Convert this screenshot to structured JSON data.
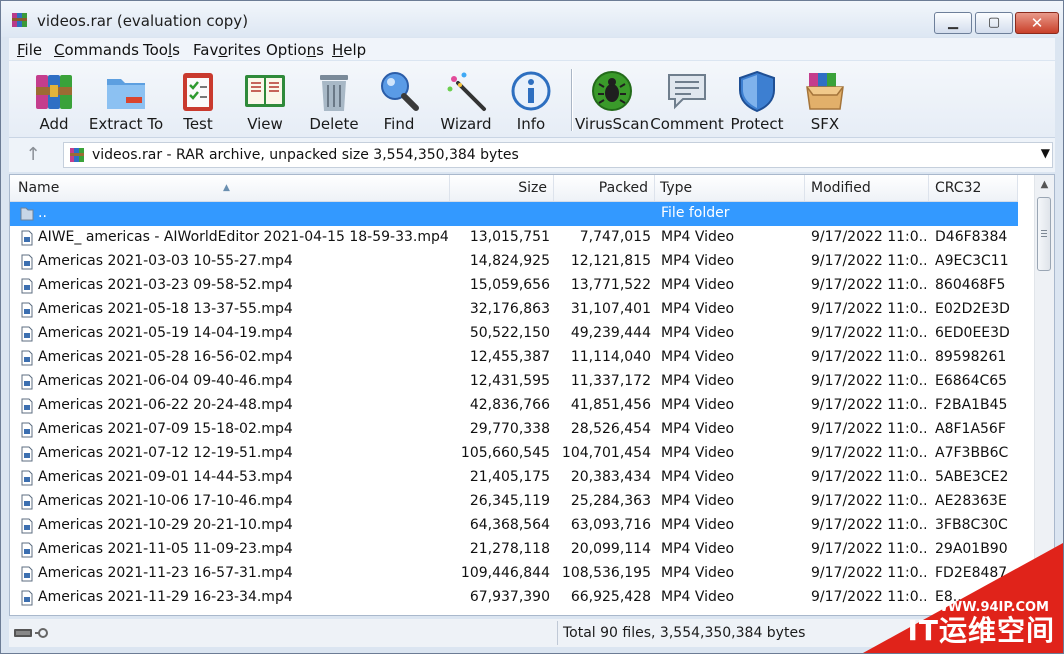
{
  "window": {
    "title": "videos.rar (evaluation copy)",
    "controls": {
      "minimize": "▁",
      "maximize": "▢",
      "close": "✕"
    }
  },
  "menu": [
    {
      "pre": "",
      "u": "F",
      "post": "ile"
    },
    {
      "pre": "",
      "u": "C",
      "post": "ommands"
    },
    {
      "pre": "Too",
      "u": "l",
      "post": "s"
    },
    {
      "pre": "Fav",
      "u": "o",
      "post": "rites"
    },
    {
      "pre": "Optio",
      "u": "n",
      "post": "s"
    },
    {
      "pre": "",
      "u": "H",
      "post": "elp"
    }
  ],
  "toolbar": [
    {
      "label": "Add",
      "icon": "add-archive-icon"
    },
    {
      "label": "Extract To",
      "icon": "extract-folder-icon"
    },
    {
      "label": "Test",
      "icon": "test-clipboard-icon"
    },
    {
      "label": "View",
      "icon": "view-book-icon"
    },
    {
      "label": "Delete",
      "icon": "delete-trash-icon"
    },
    {
      "label": "Find",
      "icon": "find-magnifier-icon"
    },
    {
      "label": "Wizard",
      "icon": "wizard-wand-icon"
    },
    {
      "label": "Info",
      "icon": "info-icon"
    },
    {
      "label": "VirusScan",
      "icon": "virusscan-bug-icon"
    },
    {
      "label": "Comment",
      "icon": "comment-bubble-icon"
    },
    {
      "label": "Protect",
      "icon": "protect-shield-icon"
    },
    {
      "label": "SFX",
      "icon": "sfx-box-icon"
    }
  ],
  "address": {
    "text": "videos.rar - RAR archive, unpacked size 3,554,350,384 bytes"
  },
  "columns": {
    "name": "Name",
    "size": "Size",
    "packed": "Packed",
    "type": "Type",
    "modified": "Modified",
    "crc": "CRC32"
  },
  "parent_row": {
    "name": "..",
    "type": "File folder"
  },
  "files": [
    {
      "name": "AIWE_ americas - AIWorldEditor 2021-04-15 18-59-33.mp4",
      "size": "13,015,751",
      "packed": "7,747,015",
      "type": "MP4 Video",
      "modified": "9/17/2022 11:0...",
      "crc": "D46F8384"
    },
    {
      "name": "Americas 2021-03-03 10-55-27.mp4",
      "size": "14,824,925",
      "packed": "12,121,815",
      "type": "MP4 Video",
      "modified": "9/17/2022 11:0...",
      "crc": "A9EC3C11"
    },
    {
      "name": "Americas 2021-03-23 09-58-52.mp4",
      "size": "15,059,656",
      "packed": "13,771,522",
      "type": "MP4 Video",
      "modified": "9/17/2022 11:0...",
      "crc": "860468F5"
    },
    {
      "name": "Americas 2021-05-18 13-37-55.mp4",
      "size": "32,176,863",
      "packed": "31,107,401",
      "type": "MP4 Video",
      "modified": "9/17/2022 11:0...",
      "crc": "E02D2E3D"
    },
    {
      "name": "Americas 2021-05-19 14-04-19.mp4",
      "size": "50,522,150",
      "packed": "49,239,444",
      "type": "MP4 Video",
      "modified": "9/17/2022 11:0...",
      "crc": "6ED0EE3D"
    },
    {
      "name": "Americas 2021-05-28 16-56-02.mp4",
      "size": "12,455,387",
      "packed": "11,114,040",
      "type": "MP4 Video",
      "modified": "9/17/2022 11:0...",
      "crc": "89598261"
    },
    {
      "name": "Americas 2021-06-04 09-40-46.mp4",
      "size": "12,431,595",
      "packed": "11,337,172",
      "type": "MP4 Video",
      "modified": "9/17/2022 11:0...",
      "crc": "E6864C65"
    },
    {
      "name": "Americas 2021-06-22 20-24-48.mp4",
      "size": "42,836,766",
      "packed": "41,851,456",
      "type": "MP4 Video",
      "modified": "9/17/2022 11:0...",
      "crc": "F2BA1B45"
    },
    {
      "name": "Americas 2021-07-09 15-18-02.mp4",
      "size": "29,770,338",
      "packed": "28,526,454",
      "type": "MP4 Video",
      "modified": "9/17/2022 11:0...",
      "crc": "A8F1A56F"
    },
    {
      "name": "Americas 2021-07-12 12-19-51.mp4",
      "size": "105,660,545",
      "packed": "104,701,454",
      "type": "MP4 Video",
      "modified": "9/17/2022 11:0...",
      "crc": "A7F3BB6C"
    },
    {
      "name": "Americas 2021-09-01 14-44-53.mp4",
      "size": "21,405,175",
      "packed": "20,383,434",
      "type": "MP4 Video",
      "modified": "9/17/2022 11:0...",
      "crc": "5ABE3CE2"
    },
    {
      "name": "Americas 2021-10-06 17-10-46.mp4",
      "size": "26,345,119",
      "packed": "25,284,363",
      "type": "MP4 Video",
      "modified": "9/17/2022 11:0...",
      "crc": "AE28363E"
    },
    {
      "name": "Americas 2021-10-29 20-21-10.mp4",
      "size": "64,368,564",
      "packed": "63,093,716",
      "type": "MP4 Video",
      "modified": "9/17/2022 11:0...",
      "crc": "3FB8C30C"
    },
    {
      "name": "Americas 2021-11-05 11-09-23.mp4",
      "size": "21,278,118",
      "packed": "20,099,114",
      "type": "MP4 Video",
      "modified": "9/17/2022 11:0...",
      "crc": "29A01B90"
    },
    {
      "name": "Americas 2021-11-23 16-57-31.mp4",
      "size": "109,446,844",
      "packed": "108,536,195",
      "type": "MP4 Video",
      "modified": "9/17/2022 11:0...",
      "crc": "FD2E8487"
    },
    {
      "name": "Americas 2021-11-29 16-23-34.mp4",
      "size": "67,937,390",
      "packed": "66,925,428",
      "type": "MP4 Video",
      "modified": "9/17/2022 11:0...",
      "crc": "E8..."
    }
  ],
  "status": {
    "summary": "Total 90 files, 3,554,350,384 bytes"
  },
  "watermark": {
    "url": "WWW.94IP.COM",
    "brand": "IT运维空间"
  },
  "colors": {
    "selection": "#3399ff",
    "watermark": "#e0231a"
  }
}
